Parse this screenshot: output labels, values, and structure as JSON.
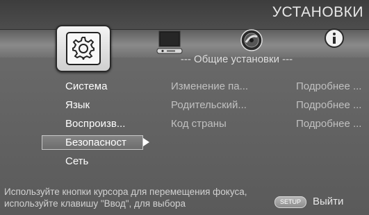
{
  "screen": {
    "title": "УСТАНОВКИ",
    "section_title": "--- Общие установки ---"
  },
  "tabs": [
    {
      "name": "settings",
      "icon": "gear-icon",
      "selected": true
    },
    {
      "name": "display",
      "icon": "monitor-icon",
      "selected": false
    },
    {
      "name": "audio",
      "icon": "speaker-icon",
      "selected": false
    },
    {
      "name": "info",
      "icon": "info-icon",
      "selected": false
    }
  ],
  "menu": {
    "items": [
      {
        "label": "Система",
        "selected": false
      },
      {
        "label": "Язык",
        "selected": false
      },
      {
        "label": "Воспроизв...",
        "selected": false
      },
      {
        "label": "Безопасност",
        "selected": true
      },
      {
        "label": "Сеть",
        "selected": false
      }
    ]
  },
  "details": {
    "rows": [
      {
        "label": "Изменение па...",
        "detail": "Подробнее ..."
      },
      {
        "label": "Родительский...",
        "detail": "Подробнее ..."
      },
      {
        "label": "Код страны",
        "detail": "Подробнее ..."
      }
    ]
  },
  "footer": {
    "hint_line1": "Используйте кнопки курсора для перемещения фокуса,",
    "hint_line2": "используйте клавишу \"Ввод\", для выбора",
    "setup_badge": "SETUP",
    "exit_label": "Выйти"
  },
  "colors": {
    "background": "#666666",
    "title_band": "#3d3d3d",
    "text": "#ffffff",
    "dim_text": "#c0c0c0"
  }
}
